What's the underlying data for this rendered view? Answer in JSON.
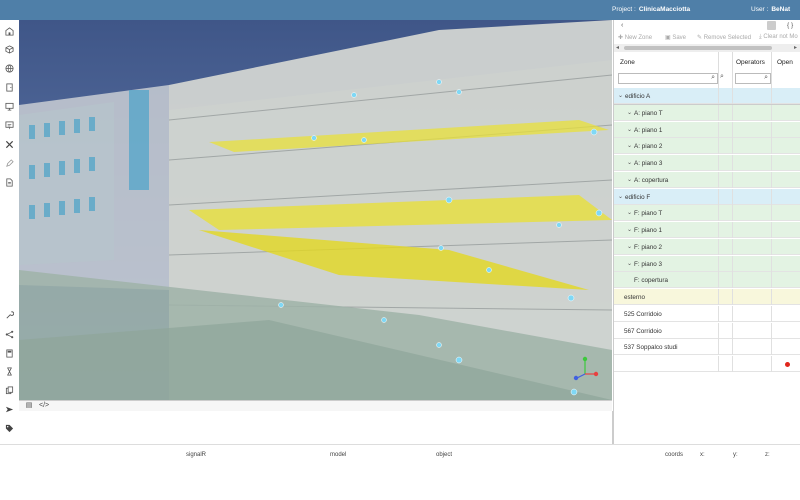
{
  "header": {
    "project_label": "Project :",
    "project_name": "ClinicaMacciotta",
    "user_label": "User :",
    "user_name": "BeNat"
  },
  "left_toolbar": {
    "top_icons": [
      "building-icon",
      "cube-icon",
      "globe-icon",
      "door-icon",
      "monitor-icon",
      "presentation-icon",
      "tools-icon",
      "edit-icon",
      "document-icon"
    ],
    "bottom_icons": [
      "wrench-icon",
      "share-icon",
      "calculator-icon",
      "hourglass-icon",
      "copy-icon",
      "send-icon",
      "tag-icon"
    ]
  },
  "panel": {
    "toolbar": {
      "new_zone": "New Zone",
      "save": "Save",
      "remove_selected": "Remove Selected",
      "clear_not_mo": "Clear not Mo"
    },
    "columns": {
      "zone": "Zone",
      "operators": "Operators",
      "open": "Open"
    },
    "rows": [
      {
        "label": "edificio A",
        "level": 0,
        "chevron": "⌄",
        "color": "blue"
      },
      {
        "label": "A: piano T",
        "level": 1,
        "chevron": "⌄",
        "color": "green"
      },
      {
        "label": "A: piano 1",
        "level": 1,
        "chevron": "⌄",
        "color": "green"
      },
      {
        "label": "A: piano 2",
        "level": 1,
        "chevron": "⌄",
        "color": "green"
      },
      {
        "label": "A: piano 3",
        "level": 1,
        "chevron": "⌄",
        "color": "green"
      },
      {
        "label": "A: copertura",
        "level": 1,
        "chevron": "⌄",
        "color": "green"
      },
      {
        "label": "edificio F",
        "level": 0,
        "chevron": "⌄",
        "color": "blue"
      },
      {
        "label": "F: piano T",
        "level": 1,
        "chevron": "⌄",
        "color": "green"
      },
      {
        "label": "F: piano 1",
        "level": 1,
        "chevron": "⌄",
        "color": "green"
      },
      {
        "label": "F: piano 2",
        "level": 1,
        "chevron": "⌄",
        "color": "green"
      },
      {
        "label": "F: piano 3",
        "level": 1,
        "chevron": "⌄",
        "color": "green"
      },
      {
        "label": "F: copertura",
        "level": 1,
        "chevron": "",
        "color": "green"
      },
      {
        "label": "esterno",
        "level": 0,
        "chevron": "",
        "color": "yellow"
      },
      {
        "label": "525 Corridoio",
        "level": 0,
        "chevron": "",
        "color": "white"
      },
      {
        "label": "567 Corridoio",
        "level": 0,
        "chevron": "",
        "color": "white"
      },
      {
        "label": "537 Soppalco studi",
        "level": 0,
        "chevron": "",
        "color": "white"
      },
      {
        "label": "",
        "level": 0,
        "chevron": "",
        "color": "white",
        "status_dot": true
      }
    ]
  },
  "statusbar": {
    "signalr": "signalR",
    "model": "model",
    "object": "object",
    "coords": "coords",
    "x": "x:",
    "y": "y:",
    "z": "z:"
  },
  "colors": {
    "header_bg": "#4f7fa8",
    "sky": "#4a5f8f",
    "highlight_slab": "#e8e03a",
    "row_blue": "#d9eef7",
    "row_green": "#e3f3e3",
    "row_yellow": "#f8f7dc",
    "status_dot": "#e0261c"
  }
}
